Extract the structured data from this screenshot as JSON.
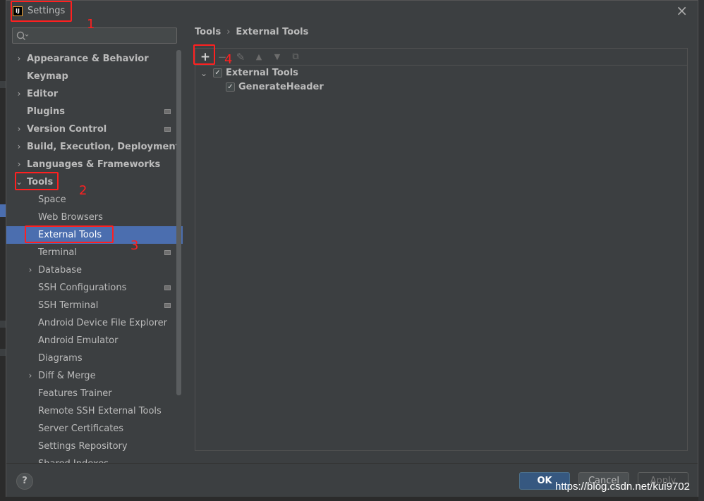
{
  "window": {
    "title": "Settings",
    "app_icon": "intellij-icon",
    "close_icon": "close-icon"
  },
  "search": {
    "placeholder": "",
    "icon": "search-icon"
  },
  "sidebar": {
    "items": [
      {
        "label": "Appearance & Behavior",
        "level": 0,
        "chevron": "right",
        "project_badge": false
      },
      {
        "label": "Keymap",
        "level": 0,
        "chevron": "none",
        "project_badge": false
      },
      {
        "label": "Editor",
        "level": 0,
        "chevron": "right",
        "project_badge": false
      },
      {
        "label": "Plugins",
        "level": 0,
        "chevron": "none",
        "project_badge": true
      },
      {
        "label": "Version Control",
        "level": 0,
        "chevron": "right",
        "project_badge": true
      },
      {
        "label": "Build, Execution, Deployment",
        "level": 0,
        "chevron": "right",
        "project_badge": false
      },
      {
        "label": "Languages & Frameworks",
        "level": 0,
        "chevron": "right",
        "project_badge": false
      },
      {
        "label": "Tools",
        "level": 0,
        "chevron": "down",
        "project_badge": false
      },
      {
        "label": "Space",
        "level": 1,
        "chevron": "none",
        "project_badge": false
      },
      {
        "label": "Web Browsers",
        "level": 1,
        "chevron": "none",
        "project_badge": false
      },
      {
        "label": "External Tools",
        "level": 1,
        "chevron": "none",
        "project_badge": false,
        "selected": true
      },
      {
        "label": "Terminal",
        "level": 1,
        "chevron": "none",
        "project_badge": true
      },
      {
        "label": "Database",
        "level": 1,
        "chevron": "right",
        "project_badge": false
      },
      {
        "label": "SSH Configurations",
        "level": 1,
        "chevron": "none",
        "project_badge": true
      },
      {
        "label": "SSH Terminal",
        "level": 1,
        "chevron": "none",
        "project_badge": true
      },
      {
        "label": "Android Device File Explorer",
        "level": 1,
        "chevron": "none",
        "project_badge": false
      },
      {
        "label": "Android Emulator",
        "level": 1,
        "chevron": "none",
        "project_badge": false
      },
      {
        "label": "Diagrams",
        "level": 1,
        "chevron": "none",
        "project_badge": false
      },
      {
        "label": "Diff & Merge",
        "level": 1,
        "chevron": "right",
        "project_badge": false
      },
      {
        "label": "Features Trainer",
        "level": 1,
        "chevron": "none",
        "project_badge": false
      },
      {
        "label": "Remote SSH External Tools",
        "level": 1,
        "chevron": "none",
        "project_badge": false
      },
      {
        "label": "Server Certificates",
        "level": 1,
        "chevron": "none",
        "project_badge": false
      },
      {
        "label": "Settings Repository",
        "level": 1,
        "chevron": "none",
        "project_badge": false
      },
      {
        "label": "Shared Indexes",
        "level": 1,
        "chevron": "none",
        "project_badge": false
      }
    ]
  },
  "breadcrumb": {
    "parent": "Tools",
    "separator": "›",
    "current": "External Tools"
  },
  "toolbar": {
    "add": "+",
    "remove": "−",
    "edit": "✎",
    "move_up": "▲",
    "move_down": "▼",
    "copy": "⧉"
  },
  "tools_tree": {
    "group": {
      "label": "External Tools",
      "checked": true,
      "expanded": true
    },
    "items": [
      {
        "label": "GenerateHeader",
        "checked": true
      }
    ]
  },
  "footer": {
    "help": "?",
    "ok": "OK",
    "cancel": "Cancel",
    "apply": "Apply"
  },
  "annotations": {
    "n1": "1",
    "n2": "2",
    "n3": "3",
    "n4": "4"
  },
  "watermark": "https://blog.csdn.net/kui9702",
  "colors": {
    "selection": "#4b6eaf",
    "annotation": "#ff2020",
    "ok_button": "#365880",
    "background": "#3c3f41"
  }
}
